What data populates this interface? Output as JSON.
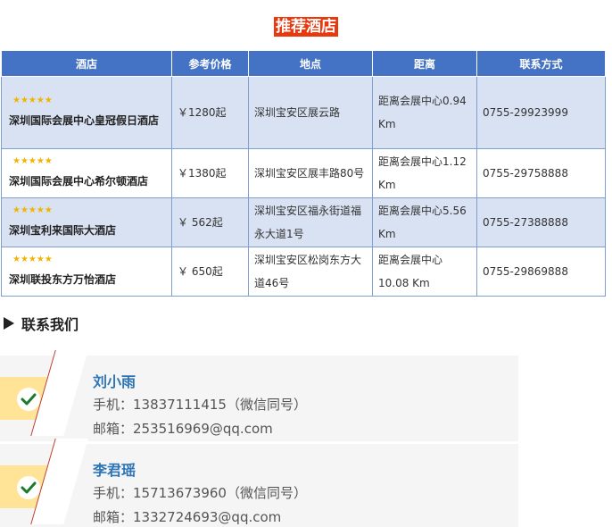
{
  "title": "推荐酒店",
  "table": {
    "headers": [
      "酒店",
      "参考价格",
      "地点",
      "距离",
      "联系方式"
    ],
    "rows": [
      {
        "stars": "★★★★★",
        "name": "深圳国际会展中心皇冠假日酒店",
        "price": "￥1280起",
        "location": "深圳宝安区展云路",
        "distance": "距离会展中心0.94 Km",
        "phone": "0755-29923999"
      },
      {
        "stars": "★★★★★",
        "name": "深圳国际会展中心希尔顿酒店",
        "price": "￥1380起",
        "location": "深圳宝安区展丰路80号",
        "distance": "距离会展中心1.12 Km",
        "phone": "0755-29758888"
      },
      {
        "stars": "★★★★★",
        "name": "深圳宝利来国际大酒店",
        "price": "￥ 562起",
        "location": "深圳宝安区福永街道福永大道1号",
        "distance": "距离会展中心5.56 Km",
        "phone": "0755-27388888"
      },
      {
        "stars": "★★★★★",
        "name": "深圳联投东方万怡酒店",
        "price": "￥ 650起",
        "location": "深圳宝安区松岗东方大道46号",
        "distance": "距离会展中心10.08 Km",
        "phone": "0755-29869888"
      }
    ]
  },
  "contact": {
    "heading": "联系我们",
    "people": [
      {
        "name": "刘小雨",
        "phone": "手机：13837111415（微信同号）",
        "email": "邮箱：253516969@qq.com"
      },
      {
        "name": "李君瑶",
        "phone": "手机：15713673960（微信同号）",
        "email": "邮箱：1332724693@qq.com"
      }
    ]
  },
  "colors": {
    "header_bg": "#4472c4",
    "stripe": "#d9e2f3",
    "title_bg": "#e8380d",
    "accent_name": "#2e75b6",
    "star": "#f0b400",
    "tab": "#ffe396",
    "check": "#1a7a2e"
  },
  "icons": [
    "triangle-right-icon",
    "check-icon",
    "star-icon"
  ]
}
